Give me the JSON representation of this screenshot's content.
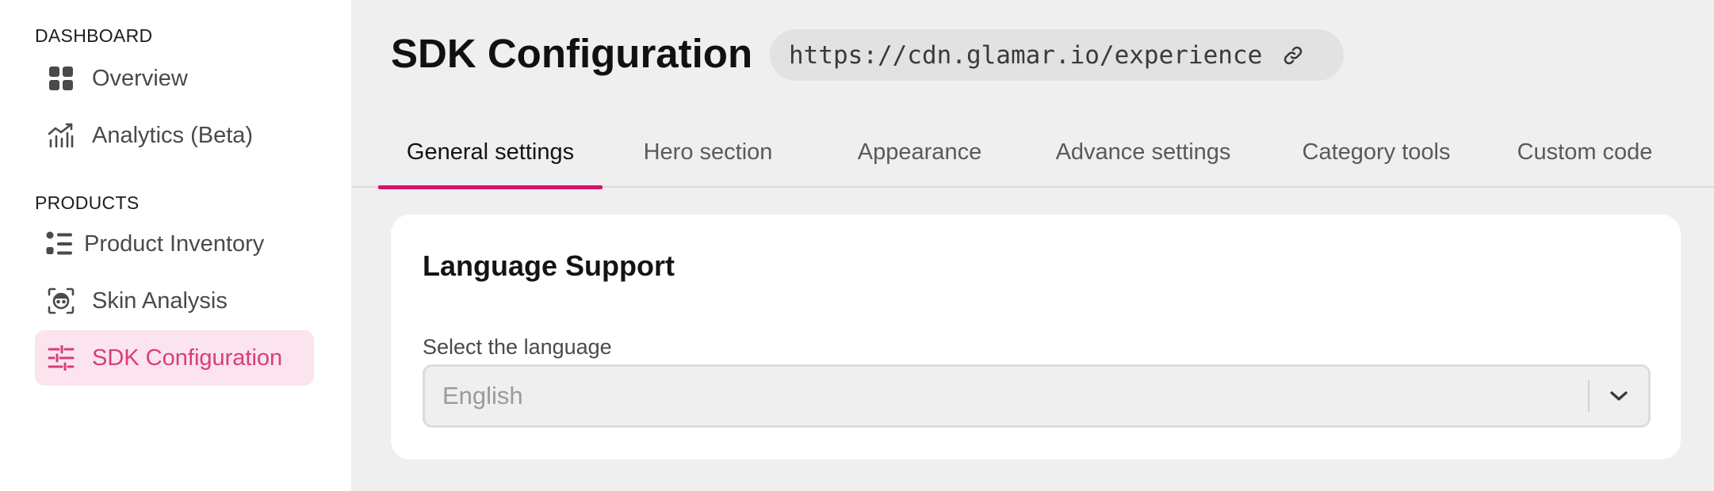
{
  "sidebar": {
    "sections": [
      {
        "header": "DASHBOARD",
        "items": [
          {
            "label": "Overview",
            "icon": "grid-icon"
          },
          {
            "label": "Analytics (Beta)",
            "icon": "analytics-icon"
          }
        ]
      },
      {
        "header": "PRODUCTS",
        "items": [
          {
            "label": "Product Inventory",
            "icon": "list-icon"
          },
          {
            "label": "Skin Analysis",
            "icon": "face-scan-icon"
          },
          {
            "label": "SDK Configuration",
            "icon": "sliders-icon",
            "active": true
          }
        ]
      }
    ]
  },
  "header": {
    "title": "SDK Configuration",
    "url": "https://cdn.glamar.io/experience"
  },
  "tabs": [
    {
      "label": "General settings",
      "active": true
    },
    {
      "label": "Hero section"
    },
    {
      "label": "Appearance"
    },
    {
      "label": "Advance settings"
    },
    {
      "label": "Category tools"
    },
    {
      "label": "Custom code"
    }
  ],
  "language_card": {
    "title": "Language Support",
    "field_label": "Select the language",
    "selected": "English"
  },
  "colors": {
    "accent": "#d8126b",
    "active_nav_bg": "#fbe4ee",
    "active_nav_text": "#d93d79"
  }
}
